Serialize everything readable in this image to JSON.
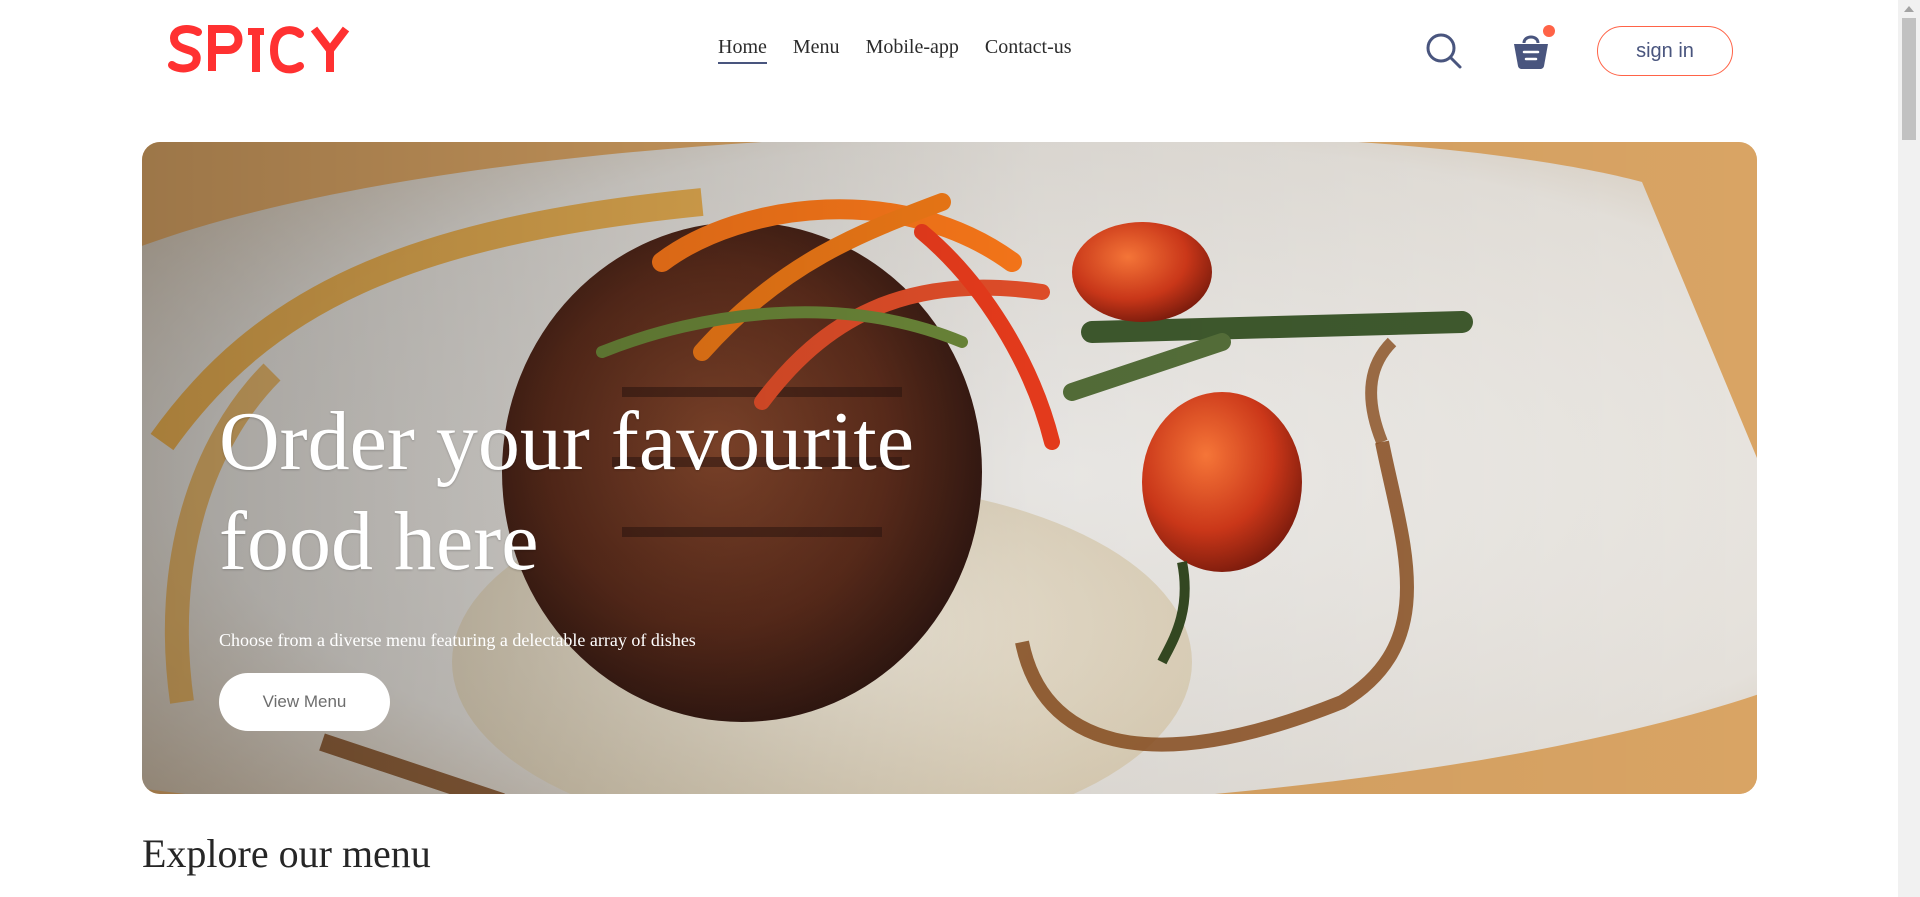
{
  "brand": {
    "logo_text": "SPICY",
    "accent_color": "#ff6347",
    "text_color": "#49557e"
  },
  "nav": {
    "links": [
      {
        "label": "Home",
        "active": true
      },
      {
        "label": "Menu",
        "active": false
      },
      {
        "label": "Mobile-app",
        "active": false
      },
      {
        "label": "Contact-us",
        "active": false
      }
    ],
    "search_icon": "search-icon",
    "basket_icon": "basket-icon",
    "signin_label": "sign in"
  },
  "hero": {
    "title_line1": "Order your favourite",
    "title_line2": "food here",
    "subtitle": "Choose from a diverse menu featuring a delectable array of dishes",
    "button_label": "View Menu"
  },
  "explore": {
    "title": "Explore our menu"
  }
}
